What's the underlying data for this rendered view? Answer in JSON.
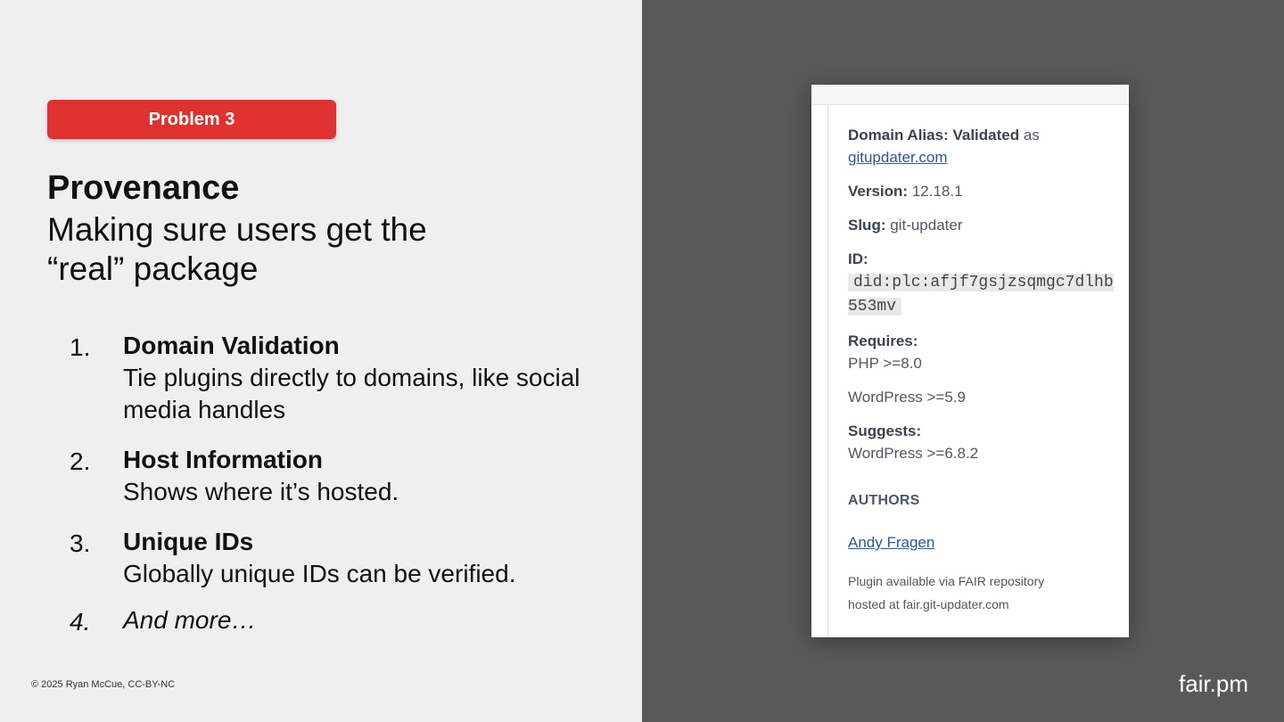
{
  "slide": {
    "badge": "Problem 3",
    "title": "Provenance",
    "subtitle": "Making sure users get the “real” package",
    "items": [
      {
        "num": "1.",
        "heading": "Domain Validation",
        "desc": "Tie plugins directly to domains, like social media handles"
      },
      {
        "num": "2.",
        "heading": "Host Information",
        "desc": "Shows where it’s hosted."
      },
      {
        "num": "3.",
        "heading": "Unique IDs",
        "desc": "Globally unique IDs can be verified."
      },
      {
        "num": "4.",
        "heading": "And more…"
      }
    ],
    "footer": "© 2025 Ryan McCue, CC-BY-NC",
    "brand": "fair.pm"
  },
  "panel": {
    "domain_alias_label": "Domain Alias",
    "domain_alias_status": "Validated",
    "domain_alias_as": "as",
    "domain_alias_link": "gitupdater.com",
    "version_label": "Version:",
    "version_value": "12.18.1",
    "slug_label": "Slug:",
    "slug_value": "git-updater",
    "id_label": "ID:",
    "id_value": "did:plc:afjf7gsjzsqmgc7dlhb553mv",
    "requires_label": "Requires:",
    "requires_php": "PHP >=8.0",
    "requires_wp": "WordPress >=5.9",
    "suggests_label": "Suggests:",
    "suggests_wp": "WordPress >=6.8.2",
    "authors_heading": "AUTHORS",
    "author_name": "Andy Fragen",
    "note_line1": "Plugin available via FAIR repository",
    "note_line2": "hosted at fair.git-updater.com"
  }
}
